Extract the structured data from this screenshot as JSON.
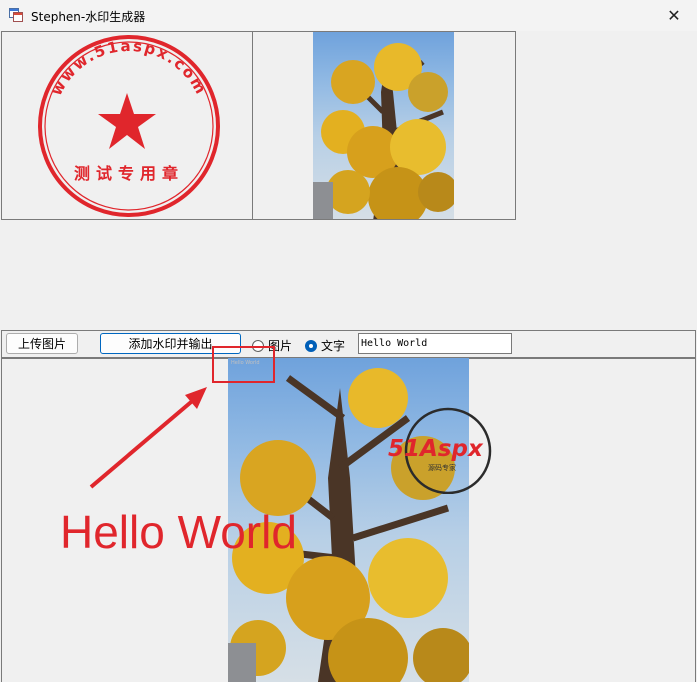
{
  "window": {
    "title": "Stephen-水印生成器",
    "close_glyph": "✕"
  },
  "stamp": {
    "url_text": "www.51aspx.com",
    "caption": "测试专用章",
    "color": "#e0262c"
  },
  "toolbar": {
    "upload_label": "上传图片",
    "add_watermark_label": "添加水印并输出",
    "radio_image_label": "图片",
    "radio_text_label": "文字",
    "radio_selected": "文字",
    "watermark_text_value": "Hello World"
  },
  "annotation": {
    "hello_label": "Hello World",
    "watermark_preview_text": "Hello World",
    "accent_color": "#e0262c"
  },
  "logo": {
    "brand_main": "51Aspx",
    "brand_sub": "源码专家",
    "colors": {
      "red": "#e0262c",
      "green": "#4caf50"
    }
  },
  "icons": {
    "app": "app-window-icon",
    "close": "close-icon",
    "arrow": "arrow-annotation-icon"
  }
}
